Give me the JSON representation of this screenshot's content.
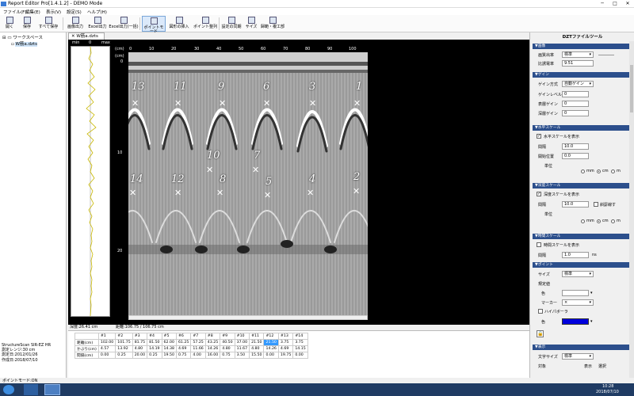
{
  "app": {
    "title": "Report Editor Pro[1.4.1.2] - DEMO Mode"
  },
  "menu": [
    "ファイル(F)",
    "編集(E)",
    "表示(V)",
    "設定(S)",
    "ヘルプ(H)"
  ],
  "toolbar": [
    "開く",
    "保存",
    "すべて保存",
    "画像出力",
    "Excel出力",
    "Excel出力(一括)",
    "ポイントモード",
    "図形の挿入",
    "ポイント整列",
    "設定の同期",
    "サイズ",
    "歸範・複工部"
  ],
  "tree": {
    "root": "ワークスペース",
    "file": "W筋a.dzts"
  },
  "doc_tab": "W筋a.dzts",
  "side_scale": {
    "min": "min",
    "zero": "0",
    "max": "max"
  },
  "axis": {
    "unit": "(cm)",
    "x_ticks": [
      "0",
      "10",
      "20",
      "30",
      "40",
      "50",
      "60",
      "70",
      "80",
      "90",
      "100"
    ],
    "y_ticks": [
      "0",
      "10",
      "20"
    ]
  },
  "markers": {
    "upper": [
      "13",
      "11",
      "9",
      "6",
      "3",
      "1"
    ],
    "mid": [
      "10",
      "7"
    ],
    "lower": [
      "14",
      "12",
      "8",
      "5",
      "4",
      "2"
    ]
  },
  "status_depth": "深度:26.41 cm",
  "status_dist": "距離:106.75 / 106.75 cm",
  "info_lines": [
    "StructureScan SIR-EZ HR",
    "測定レンジ:30 cm",
    "測定日:2012/01/26",
    "作成日:2018/07/10"
  ],
  "table": {
    "headers": [
      "",
      "#1",
      "#2",
      "#3",
      "#4",
      "#5",
      "#6",
      "#7",
      "#8",
      "#9",
      "#10",
      "#11",
      "#12",
      "#13",
      "#14"
    ],
    "rows": [
      [
        "距離(cm)",
        "102.00",
        "101.75",
        "81.75",
        "81.50",
        "62.00",
        "61.25",
        "57.25",
        "43.25",
        "40.50",
        "37.00",
        "21.50",
        "21.50",
        "3.75",
        "3.75"
      ],
      [
        "かぶり(cm)",
        "4.57",
        "13.92",
        "4.80",
        "14.19",
        "14.38",
        "4.69",
        "11.66",
        "14.26",
        "4.80",
        "11.67",
        "4.80",
        "14.26",
        "4.69",
        "14.15"
      ],
      [
        "間隔(cm)",
        "0.00",
        "0.25",
        "20.00",
        "0.25",
        "19.50",
        "0.75",
        "4.00",
        "16.00",
        "0.75",
        "3.50",
        "15.50",
        "0.00",
        "19.75",
        "0.00"
      ]
    ]
  },
  "right": {
    "title": "DZTファイルツール",
    "sec_image": "▼画像",
    "img_mode_lbl": "画質出率",
    "img_mode": "標準",
    "ratio_lbl": "比誘電率",
    "ratio": "9.51",
    "sec_gain": "▼ゲイン",
    "gain_mode_lbl": "ゲイン方式",
    "gain_mode": "自動ゲイン",
    "gain_level_lbl": "ゲインレベル",
    "gain_level": "0",
    "surface_lbl": "表層ゲイン",
    "surface": "0",
    "deep_lbl": "深層ゲイン",
    "deep": "0",
    "sec_hscale": "▼水平スケール",
    "hscale_cb": "水平スケールを表示",
    "hint_lbl": "間隔",
    "hint": "10.0",
    "hstart_lbl": "開始位置",
    "hstart": "0.0",
    "hunit_lbl": "単位",
    "units": [
      "mm",
      "cm",
      "m"
    ],
    "sec_vscale": "▼深度スケール",
    "vscale_cb": "深度スケールを表示",
    "vint_lbl": "間隔",
    "vint": "10.0",
    "negative": "斜罫線す",
    "vunit_lbl": "単位",
    "sec_tscale": "▼時間スケール",
    "tscale_cb": "時間スケールを表示",
    "tint_lbl": "間隔",
    "tint": "1.0",
    "tunit": "ns",
    "sec_point": "▼ポイント",
    "size_lbl": "サイズ",
    "size": "標準",
    "spec_lbl": "規定値",
    "color_lbl": "色",
    "marker_lbl": "マーカー",
    "marker": "×",
    "highlight": "ハイパボーラ",
    "color2_lbl": "色",
    "sec_label": "▼表示",
    "font_lbl": "文字サイズ",
    "font": "標準",
    "col_target": "対象",
    "col_show": "表示",
    "col_select": "選択"
  },
  "bottom_status": "ポイントモード:ON",
  "tray": {
    "time": "10:28",
    "date": "2018/07/10"
  }
}
